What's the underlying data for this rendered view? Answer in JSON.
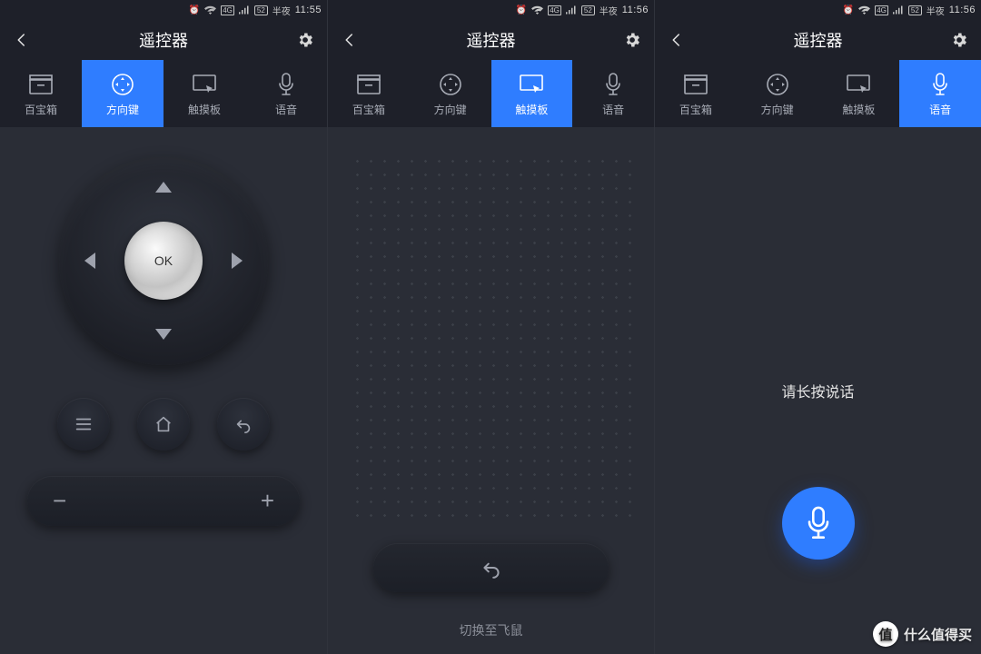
{
  "statusbar": {
    "battery_text": "52",
    "carrier_text": "半夜",
    "time1": "11:55",
    "time2": "11:56"
  },
  "header": {
    "title": "遥控器"
  },
  "tabs": {
    "toolbox": "百宝箱",
    "dpad": "方向键",
    "touchpad": "触摸板",
    "voice": "语音"
  },
  "dpad": {
    "ok": "OK",
    "minus": "−",
    "plus": "+"
  },
  "touchpad": {
    "switch": "切换至飞鼠"
  },
  "voice": {
    "hint": "请长按说话"
  },
  "watermark": {
    "badge": "值",
    "text": "什么值得买"
  }
}
